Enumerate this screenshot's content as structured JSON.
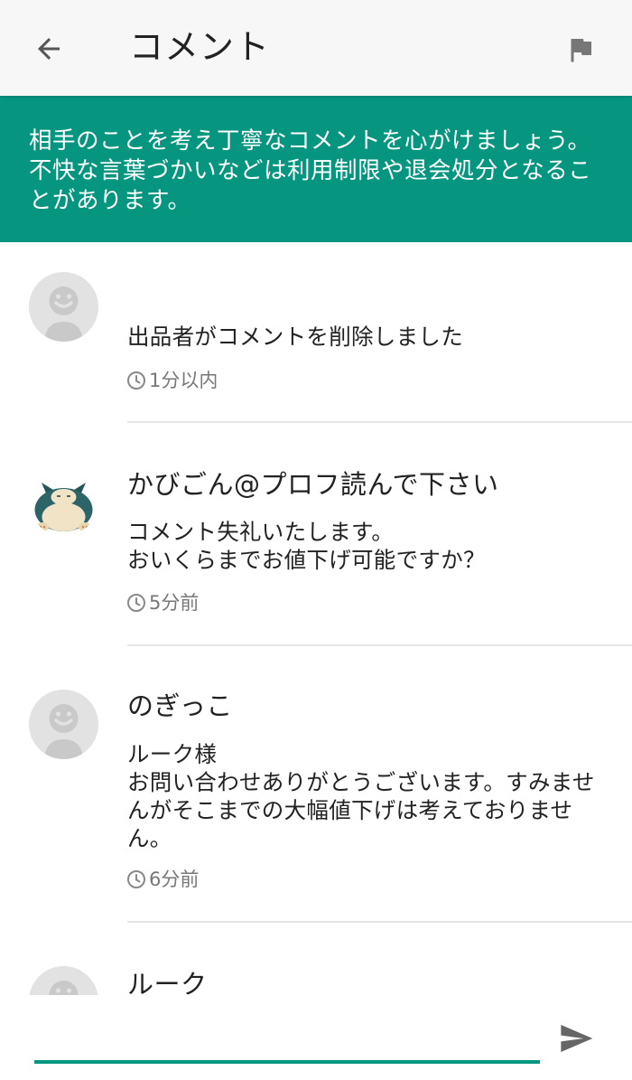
{
  "header": {
    "title": "コメント",
    "back_icon": "arrow-left-icon",
    "flag_icon": "flag-icon"
  },
  "notice": {
    "text": "相手のことを考え丁寧なコメントを心がけましょう。不快な言葉づかいなどは利用制限や退会処分となることがあります。"
  },
  "colors": {
    "accent": "#069680",
    "appbar_bg": "#f7f7f7",
    "divider": "#e6e6e6",
    "muted_text": "#777777"
  },
  "comments": [
    {
      "author": "",
      "avatar": "default-avatar",
      "body": "出品者がコメントを削除しました",
      "time": "1分以内"
    },
    {
      "author": "かびごん@プロフ読んで下さい",
      "avatar": "snorlax-avatar",
      "body": "コメント失礼いたします。\nおいくらまでお値下げ可能ですか？",
      "time": "5分前"
    },
    {
      "author": "のぎっこ",
      "avatar": "default-avatar",
      "body": "ルーク様\nお問い合わせありがとうございます。すみませんがそこまでの大幅値下げは考えておりません。",
      "time": "6分前"
    },
    {
      "author": "ルーク",
      "avatar": "default-avatar",
      "body": "",
      "time": ""
    }
  ],
  "input": {
    "placeholder": "",
    "value": "",
    "send_icon": "send-icon"
  }
}
